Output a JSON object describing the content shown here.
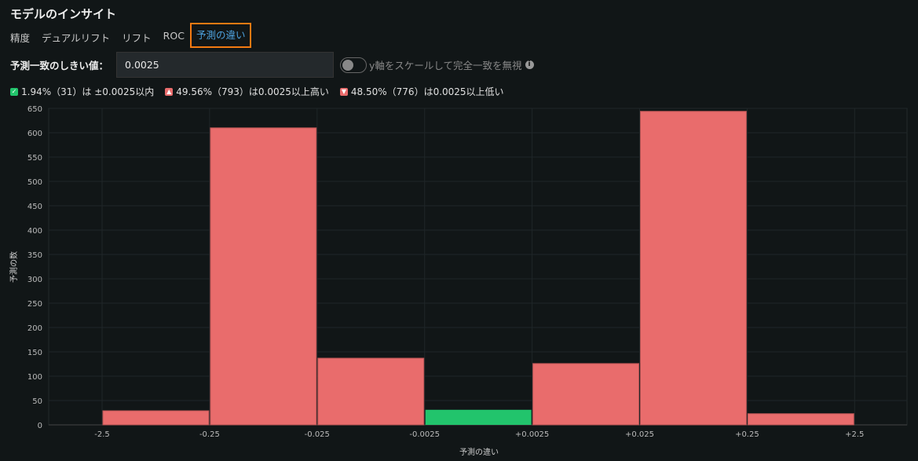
{
  "title": "モデルのインサイト",
  "tabs": [
    "精度",
    "デュアルリフト",
    "リフト",
    "ROC",
    "予測の違い"
  ],
  "active_tab": 4,
  "threshold": {
    "label": "予測一致のしきい値：",
    "value": "0.0025"
  },
  "toggle": {
    "label": "y軸をスケールして完全一致を無視",
    "on": false
  },
  "legend": [
    {
      "text": "1.94%（31）は ±0.0025以内",
      "color": "#22c46c",
      "icon": "check-icon"
    },
    {
      "text": "49.56%（793）は0.0025以上高い",
      "color": "#e96c6c",
      "icon": "arrow-up-icon"
    },
    {
      "text": "48.50%（776）は0.0025以上低い",
      "color": "#e96c6c",
      "icon": "arrow-down-icon"
    }
  ],
  "chart_data": {
    "type": "bar",
    "xlabel": "予測の違い",
    "ylabel": "予測の数",
    "ylim": [
      0,
      650
    ],
    "yticks": [
      0,
      50,
      100,
      150,
      200,
      250,
      300,
      350,
      400,
      450,
      500,
      550,
      600,
      650
    ],
    "xticks": [
      "-2.5",
      "-0.25",
      "-0.025",
      "-0.0025",
      "+0.0025",
      "+0.025",
      "+0.25",
      "+2.5"
    ],
    "bins": [
      {
        "from": "-2.5",
        "to": "-0.25",
        "value": 29,
        "color": "#e96c6c"
      },
      {
        "from": "-0.25",
        "to": "-0.025",
        "value": 610,
        "color": "#e96c6c"
      },
      {
        "from": "-0.025",
        "to": "-0.0025",
        "value": 137,
        "color": "#e96c6c"
      },
      {
        "from": "-0.0025",
        "to": "+0.0025",
        "value": 31,
        "color": "#22c46c"
      },
      {
        "from": "+0.0025",
        "to": "+0.025",
        "value": 126,
        "color": "#e96c6c"
      },
      {
        "from": "+0.025",
        "to": "+0.25",
        "value": 644,
        "color": "#e96c6c"
      },
      {
        "from": "+0.25",
        "to": "+2.5",
        "value": 23,
        "color": "#e96c6c"
      }
    ]
  }
}
